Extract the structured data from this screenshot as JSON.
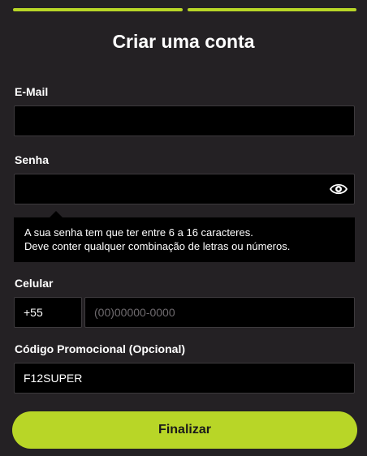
{
  "colors": {
    "accent": "#b8d627",
    "background": "#242124",
    "field": "#000000"
  },
  "form": {
    "title": "Criar uma conta",
    "email": {
      "label": "E-Mail",
      "value": "",
      "placeholder": ""
    },
    "password": {
      "label": "Senha",
      "value": "",
      "placeholder": "",
      "toggle_icon": "eye-icon",
      "hint_line1": "A sua senha tem que ter entre 6 a 16 caracteres.",
      "hint_line2": "Deve conter qualquer combinação de letras ou números."
    },
    "phone": {
      "label": "Celular",
      "country_code": "+55",
      "value": "",
      "placeholder": "(00)00000-0000"
    },
    "promo": {
      "label": "Código Promocional (Opcional)",
      "value": "F12SUPER",
      "placeholder": ""
    },
    "submit_label": "Finalizar"
  }
}
